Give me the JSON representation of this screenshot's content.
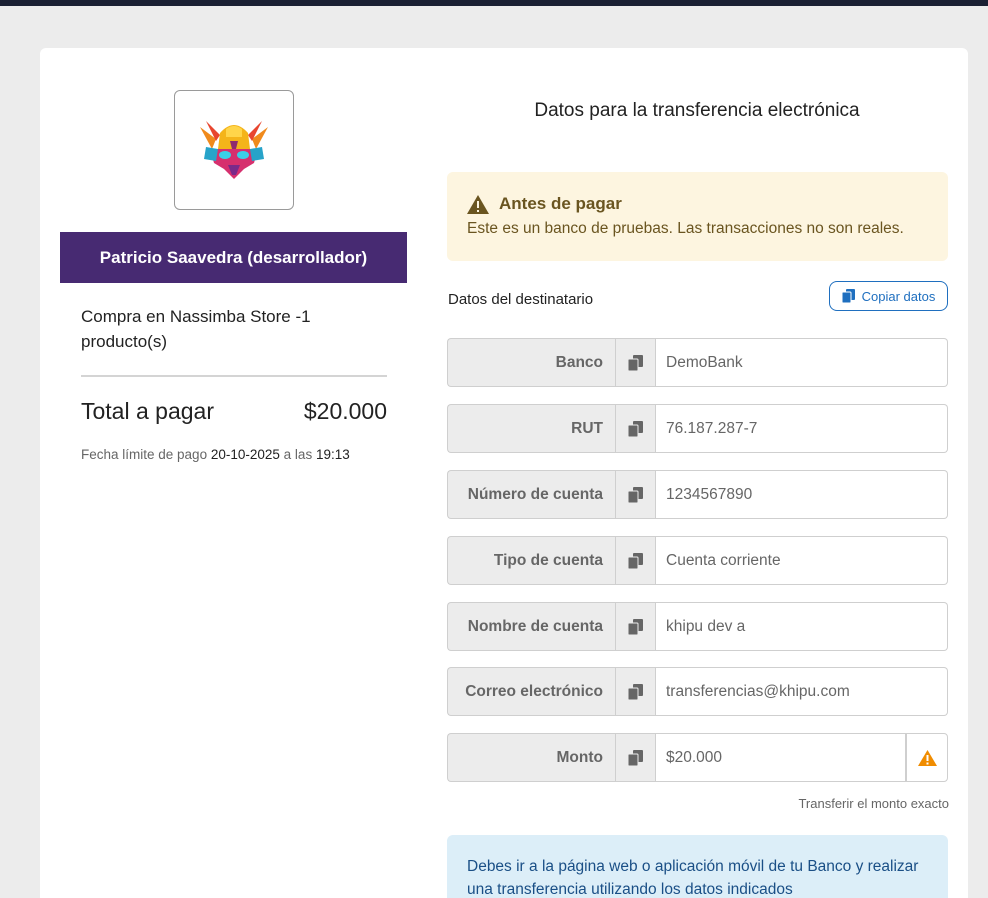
{
  "merchant": {
    "name": "Patricio Saavedra (desarrollador)",
    "logo_icon": "mask-logo-icon"
  },
  "purchase": {
    "description": "Compra en Nassimba Store -1 producto(s)",
    "total_label": "Total a pagar",
    "total_value": "$20.000",
    "deadline_prefix": "Fecha límite de pago",
    "deadline_date": "20-10-2025",
    "deadline_mid": "a las",
    "deadline_time": "19:13"
  },
  "transfer": {
    "title": "Datos para la transferencia electrónica",
    "warning_title": "Antes de pagar",
    "warning_text": "Este es un banco de pruebas. Las transacciones no son reales.",
    "recipient_label": "Datos del destinatario",
    "copy_button": "Copiar datos",
    "fields": [
      {
        "label": "Banco",
        "value": "DemoBank"
      },
      {
        "label": "RUT",
        "value": "76.187.287-7"
      },
      {
        "label": "Número de cuenta",
        "value": "1234567890"
      },
      {
        "label": "Tipo de cuenta",
        "value": "Cuenta corriente"
      },
      {
        "label": "Nombre de cuenta",
        "value": "khipu dev a"
      },
      {
        "label": "Correo electrónico",
        "value": "transferencias@khipu.com"
      },
      {
        "label": "Monto",
        "value": "$20.000"
      }
    ],
    "exact_amount_note": "Transferir el monto exacto",
    "info_text": "Debes ir a la página web o aplicación móvil de tu Banco y realizar una transferencia utilizando los datos indicados"
  },
  "colors": {
    "brand": "#472a72",
    "warning_bg": "#fdf5e0",
    "info_bg": "#dceef8",
    "link": "#1f6fbf",
    "alert_orange": "#f08c00"
  }
}
